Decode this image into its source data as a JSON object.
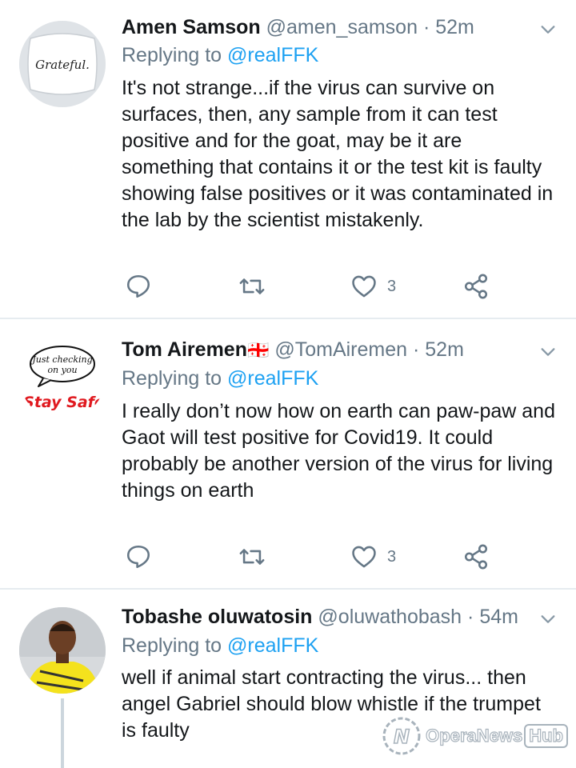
{
  "tweets": [
    {
      "name": "Amen Samson",
      "handle": "@amen_samson",
      "time": "52m",
      "replying_prefix": "Replying to",
      "replying_to": "@realFFK",
      "text": "It's not strange...if the virus can survive on surfaces, then, any sample from it can test positive and for the goat, may be it are something that contains it or the test kit is faulty showing false positives or it was contaminated in the lab by the scientist mistakenly.",
      "likes": "3",
      "avatar_text": "Grateful."
    },
    {
      "name": "Tom Airemen",
      "handle": "@TomAiremen",
      "time": "52m",
      "replying_prefix": "Replying to",
      "replying_to": "@realFFK",
      "text": "I really don’t now how on earth can paw-paw and Gaot will test positive for Covid19. It could probably be another version of the virus for living things on earth",
      "likes": "3",
      "avatar_bubble_text": "Just checking on you",
      "avatar_bottom_text": "Stay Safe"
    },
    {
      "name": "Tobashe oluwatosin",
      "handle": "@oluwathobash",
      "time": "54m",
      "replying_prefix": "Replying to",
      "replying_to": "@realFFK",
      "text": "well if animal start contracting the virus...  then angel Gabriel should blow whistle if the trumpet is faulty"
    }
  ],
  "separator": "·",
  "flag_emoji": "🇬🇪",
  "watermark": {
    "brand": "OperaNews",
    "hub": "Hub"
  },
  "colors": {
    "accent": "#1da1f2",
    "muted": "#657786",
    "icon": "#657786",
    "divider": "#e6ecf0"
  }
}
